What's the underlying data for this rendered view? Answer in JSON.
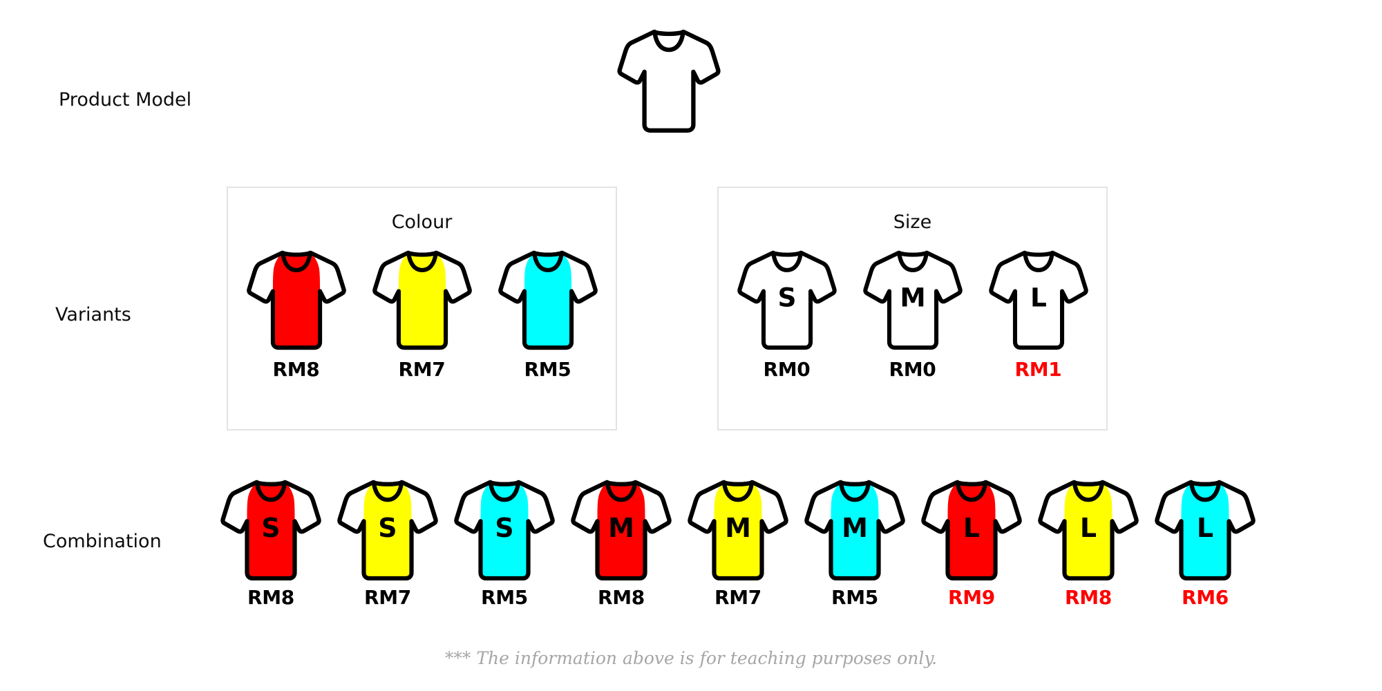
{
  "rows": {
    "product_model_label": "Product Model",
    "variants_label": "Variants",
    "combination_label": "Combination"
  },
  "colors": {
    "red": "#ff0000",
    "yellow": "#ffff00",
    "cyan": "#00ffff",
    "white": "#ffffff",
    "outline": "#000000",
    "box_border": "#e3e3e3",
    "highlight_text": "#ff0000",
    "footer_text": "#a6a6a6"
  },
  "variant_groups": [
    {
      "title": "Colour",
      "items": [
        {
          "name": "red",
          "fill": "#ff0000",
          "letter": "",
          "price": "RM8",
          "highlight": false
        },
        {
          "name": "yellow",
          "fill": "#ffff00",
          "letter": "",
          "price": "RM7",
          "highlight": false
        },
        {
          "name": "cyan",
          "fill": "#00ffff",
          "letter": "",
          "price": "RM5",
          "highlight": false
        }
      ]
    },
    {
      "title": "Size",
      "items": [
        {
          "name": "small",
          "fill": "#ffffff",
          "letter": "S",
          "price": "RM0",
          "highlight": false
        },
        {
          "name": "medium",
          "fill": "#ffffff",
          "letter": "M",
          "price": "RM0",
          "highlight": false
        },
        {
          "name": "large",
          "fill": "#ffffff",
          "letter": "L",
          "price": "RM1",
          "highlight": true
        }
      ]
    }
  ],
  "combinations": [
    {
      "name": "red-small",
      "fill": "#ff0000",
      "letter": "S",
      "price": "RM8",
      "highlight": false
    },
    {
      "name": "yellow-small",
      "fill": "#ffff00",
      "letter": "S",
      "price": "RM7",
      "highlight": false
    },
    {
      "name": "cyan-small",
      "fill": "#00ffff",
      "letter": "S",
      "price": "RM5",
      "highlight": false
    },
    {
      "name": "red-medium",
      "fill": "#ff0000",
      "letter": "M",
      "price": "RM8",
      "highlight": false
    },
    {
      "name": "yellow-medium",
      "fill": "#ffff00",
      "letter": "M",
      "price": "RM7",
      "highlight": false
    },
    {
      "name": "cyan-medium",
      "fill": "#00ffff",
      "letter": "M",
      "price": "RM5",
      "highlight": false
    },
    {
      "name": "red-large",
      "fill": "#ff0000",
      "letter": "L",
      "price": "RM9",
      "highlight": true
    },
    {
      "name": "yellow-large",
      "fill": "#ffff00",
      "letter": "L",
      "price": "RM8",
      "highlight": true
    },
    {
      "name": "cyan-large",
      "fill": "#00ffff",
      "letter": "L",
      "price": "RM6",
      "highlight": true
    }
  ],
  "footer": {
    "note": "*** The information above is for teaching purposes only."
  }
}
